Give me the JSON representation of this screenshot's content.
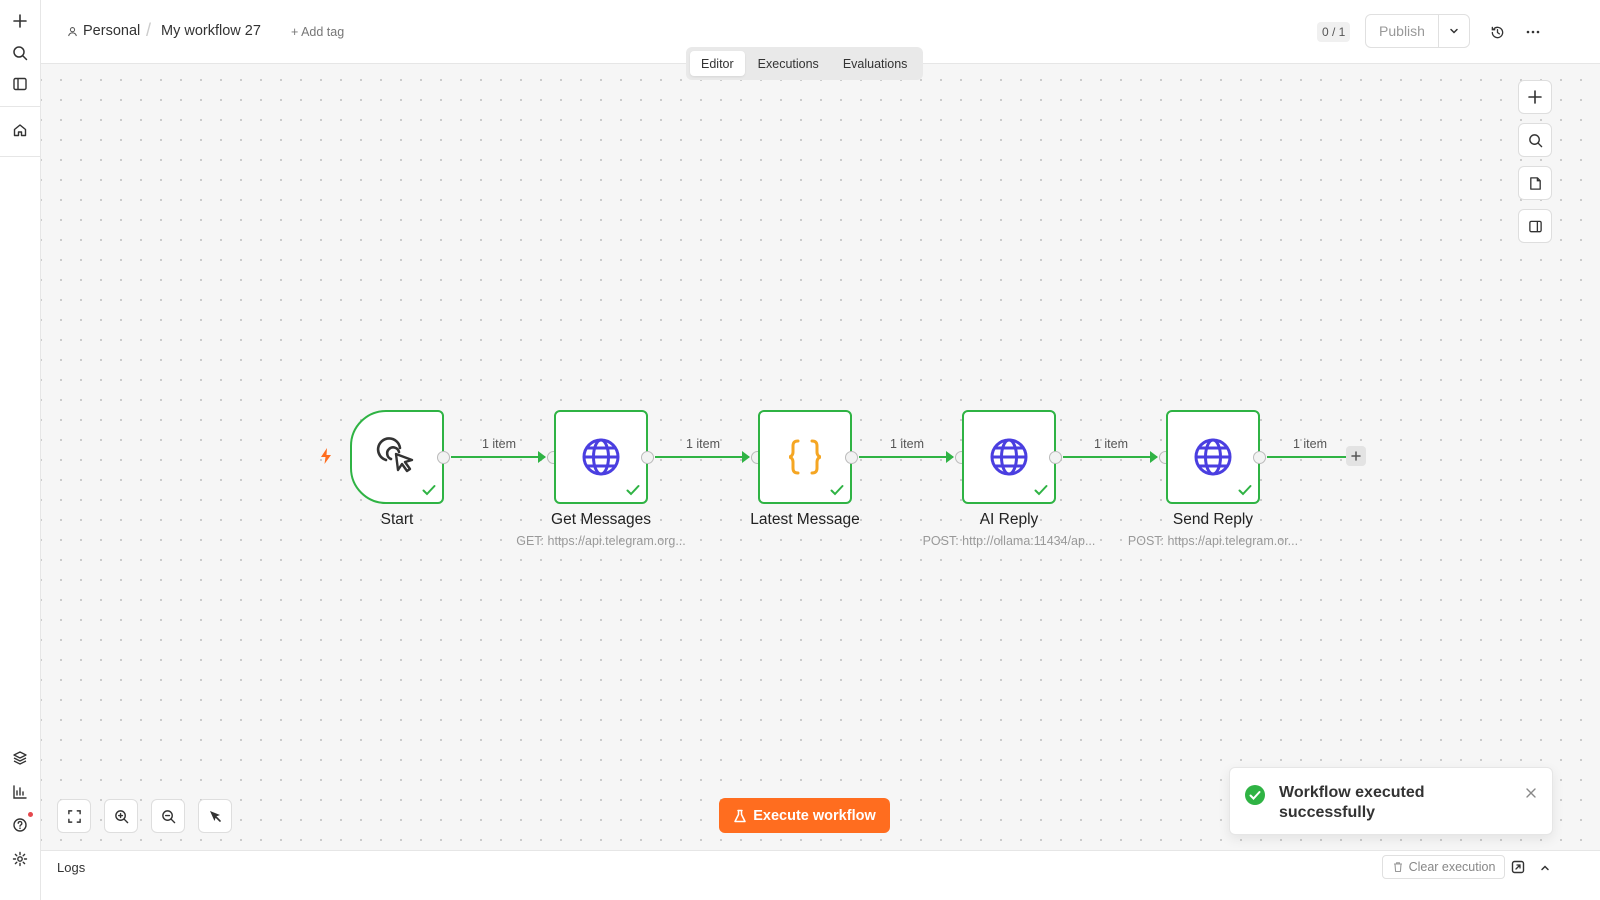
{
  "header": {
    "project": "Personal",
    "separator": "/",
    "workflow_name": "My workflow 27",
    "add_tag": "+ Add tag",
    "counter": "0 / 1",
    "publish_label": "Publish"
  },
  "tabs": [
    {
      "label": "Editor",
      "active": true
    },
    {
      "label": "Executions",
      "active": false
    },
    {
      "label": "Evaluations",
      "active": false
    }
  ],
  "nodes": [
    {
      "title": "Start",
      "subtitle": "",
      "icon": "cursor-click-icon",
      "status": "success"
    },
    {
      "title": "Get Messages",
      "subtitle": "GET: https://api.telegram.org...",
      "icon": "globe-icon",
      "status": "success"
    },
    {
      "title": "Latest Message",
      "subtitle": "",
      "icon": "code-braces-icon",
      "status": "success"
    },
    {
      "title": "AI Reply",
      "subtitle": "POST: http://ollama:11434/ap...",
      "icon": "globe-icon",
      "status": "success"
    },
    {
      "title": "Send Reply",
      "subtitle": "POST: https://api.telegram.or...",
      "icon": "globe-icon",
      "status": "success"
    }
  ],
  "edges": [
    {
      "label": "1 item"
    },
    {
      "label": "1 item"
    },
    {
      "label": "1 item"
    },
    {
      "label": "1 item"
    },
    {
      "label": "1 item"
    }
  ],
  "canvas": {
    "execute_label": "Execute workflow"
  },
  "toast": {
    "message": "Workflow executed successfully"
  },
  "logs": {
    "title": "Logs",
    "clear_label": "Clear execution"
  },
  "colors": {
    "success": "#2fb344",
    "accent": "#ff6d1f",
    "globe": "#4a3ee0",
    "code": "#f5a623",
    "trigger_bolt": "#ff6d1f"
  }
}
